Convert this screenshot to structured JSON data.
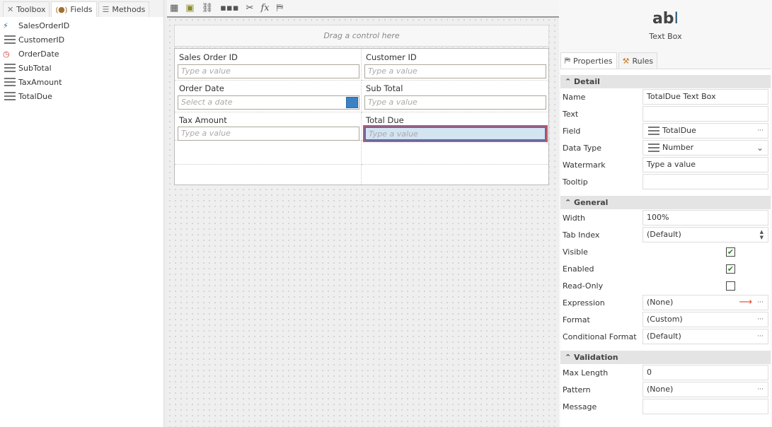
{
  "left_panel": {
    "tabs": [
      {
        "label": "Toolbox",
        "icon": "wrench-icon"
      },
      {
        "label": "Fields",
        "icon": "fields-icon"
      },
      {
        "label": "Methods",
        "icon": "methods-icon"
      }
    ],
    "fields": [
      "SalesOrderID",
      "CustomerID",
      "OrderDate",
      "SubTotal",
      "TaxAmount",
      "TotalDue"
    ]
  },
  "canvas": {
    "drag_hint": "Drag a control here",
    "controls": [
      {
        "label": "Sales Order ID",
        "placeholder": "Type a value"
      },
      {
        "label": "Customer ID",
        "placeholder": "Type a value"
      },
      {
        "label": "Order Date",
        "placeholder": "Select a date"
      },
      {
        "label": "Sub Total",
        "placeholder": "Type a value"
      },
      {
        "label": "Tax Amount",
        "placeholder": "Type a value"
      },
      {
        "label": "Total Due",
        "placeholder": "Type a value"
      }
    ]
  },
  "control": {
    "icon_text": "ab",
    "name": "Text Box"
  },
  "prop_tabs": [
    "Properties",
    "Rules"
  ],
  "sections": {
    "detail": "Detail",
    "general": "General",
    "validation": "Validation"
  },
  "props": {
    "name": [
      "Name",
      "TotalDue Text Box"
    ],
    "text": [
      "Text",
      ""
    ],
    "field": [
      "Field",
      "TotalDue"
    ],
    "datatype": [
      "Data Type",
      "Number"
    ],
    "watermark": [
      "Watermark",
      "Type a value"
    ],
    "tooltip": [
      "Tooltip",
      ""
    ],
    "width": [
      "Width",
      "100%"
    ],
    "tabindex": [
      "Tab Index",
      "(Default)"
    ],
    "visible": [
      "Visible",
      true
    ],
    "enabled": [
      "Enabled",
      true
    ],
    "readonly": [
      "Read-Only",
      false
    ],
    "expression": [
      "Expression",
      "(None)"
    ],
    "format": [
      "Format",
      "(Custom)"
    ],
    "condformat": [
      "Conditional Format",
      "(Default)"
    ],
    "maxlength": [
      "Max Length",
      "0"
    ],
    "pattern": [
      "Pattern",
      "(None)"
    ],
    "message": [
      "Message",
      ""
    ]
  },
  "ellipsis": "···"
}
